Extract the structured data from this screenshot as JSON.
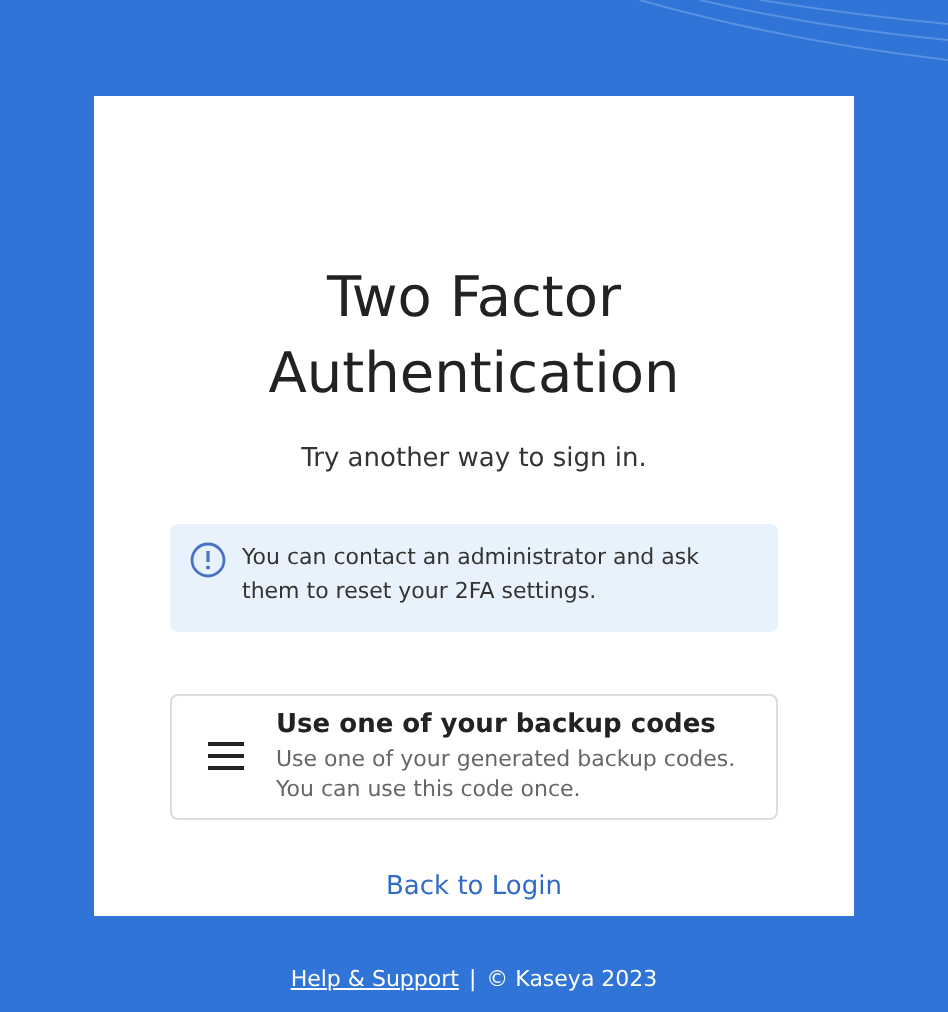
{
  "card": {
    "title": "Two Factor Authentication",
    "subtitle": "Try another way to sign in."
  },
  "info": {
    "text": "You can contact an administrator and ask them to reset your 2FA settings."
  },
  "options": [
    {
      "kind": "backup",
      "title": "Use one of your backup codes",
      "description": "Use one of your generated backup codes. You can use this code once."
    }
  ],
  "back_link": "Back to Login",
  "footer": {
    "link": "Help & Support",
    "separator": "|",
    "copyright": "© Kaseya 2023"
  }
}
